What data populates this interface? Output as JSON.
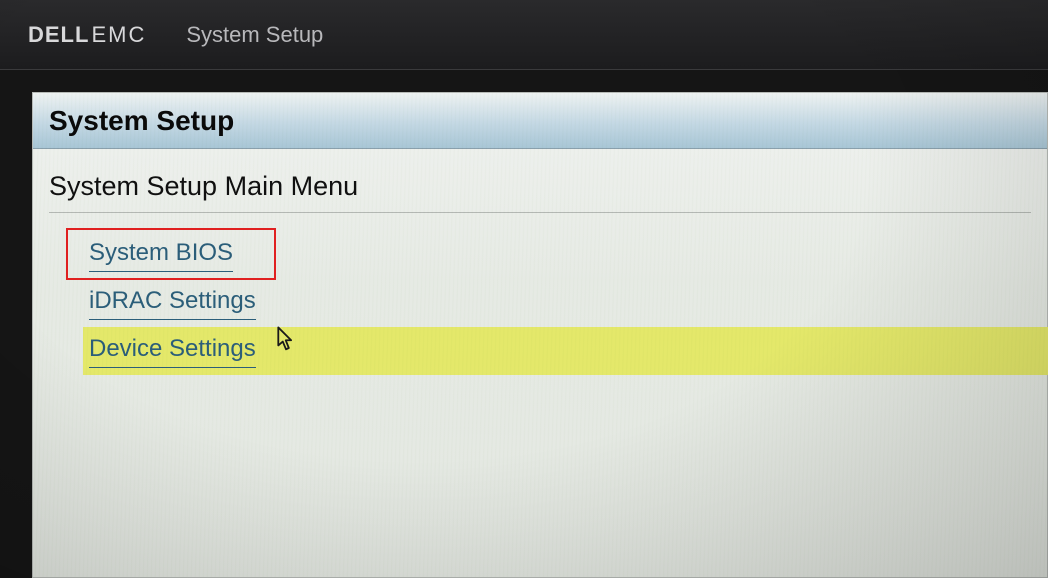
{
  "topbar": {
    "brand_dell": "DELL",
    "brand_emc": "EMC",
    "title": "System Setup"
  },
  "panel": {
    "title": "System Setup",
    "section_title": "System Setup Main Menu"
  },
  "menu": {
    "items": [
      {
        "label": "System BIOS"
      },
      {
        "label": "iDRAC Settings"
      },
      {
        "label": "Device Settings"
      }
    ]
  },
  "annotation": {
    "highlight_color": "#e02020",
    "selected_bg": "#e4e86a"
  }
}
